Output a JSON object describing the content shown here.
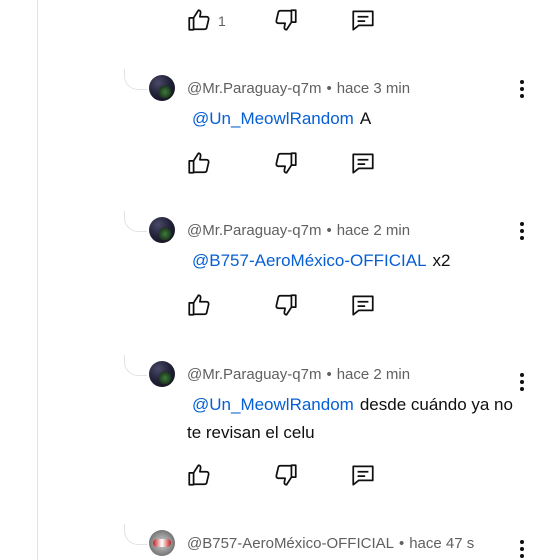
{
  "top_actions": {
    "like_count": "1"
  },
  "replies": [
    {
      "author": "@Mr.Paraguay-q7m",
      "separator": "•",
      "time": "hace 3 min",
      "mention": "@Un_MeowlRandom",
      "text": "A"
    },
    {
      "author": "@Mr.Paraguay-q7m",
      "separator": "•",
      "time": "hace 2 min",
      "mention": "@B757-AeroMéxico-OFFICIAL",
      "text": "x2"
    },
    {
      "author": "@Mr.Paraguay-q7m",
      "separator": "•",
      "time": "hace 2 min",
      "mention": "@Un_MeowlRandom",
      "text": "desde cuándo ya no te revisan el celu"
    },
    {
      "author": "@B757-AeroMéxico-OFFICIAL",
      "separator": "•",
      "time": "hace 47 s"
    }
  ],
  "icons": {
    "like": "thumb-up-icon",
    "dislike": "thumb-down-icon",
    "reply": "comment-reply-icon",
    "more": "more-vertical-icon"
  },
  "colors": {
    "mention": "#065fd4",
    "meta": "#606060",
    "text": "#0f0f0f",
    "thread_line": "#e3e3e3"
  }
}
